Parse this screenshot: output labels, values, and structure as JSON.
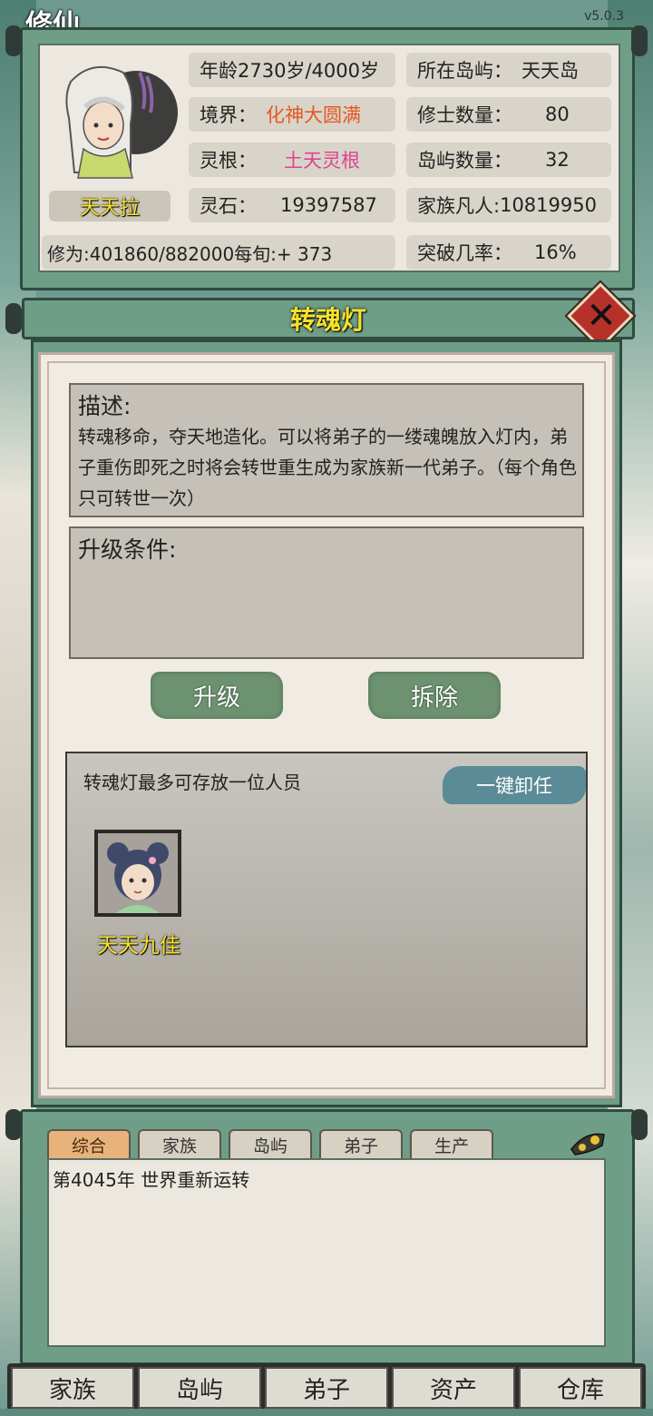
{
  "app": {
    "corner_title": "修仙",
    "version": "v5.0.3"
  },
  "info": {
    "player_name": "天天拉",
    "age": {
      "label": "年龄",
      "value": "2730岁/4000岁"
    },
    "island": {
      "label": "所在岛屿：",
      "value": "天天岛"
    },
    "realm": {
      "label": "境界：",
      "value": "化神大圆满"
    },
    "cultivator_count": {
      "label": "修士数量：",
      "value": "80"
    },
    "spirit_root": {
      "label": "灵根：",
      "value": "土天灵根"
    },
    "island_count": {
      "label": "岛屿数量：",
      "value": "32"
    },
    "spirit_stone": {
      "label": "灵石：",
      "value": "19397587"
    },
    "clan_mortals": {
      "label": "家族凡人:",
      "value": "10819950"
    },
    "cultivation": {
      "label": "修为:",
      "value": "401860/882000每旬:+ 373"
    },
    "breakthrough": {
      "label": "突破几率：",
      "value": "16%"
    },
    "colors": {
      "realm": "#e6571f",
      "spirit_root": "#e0428f",
      "name": "#f7e22a"
    }
  },
  "dialog": {
    "title": "转魂灯",
    "close_icon": "close-x-icon",
    "description_title": "描述:",
    "description_text": "转魂移命，夺天地造化。可以将弟子的一缕魂魄放入灯内，弟子重伤即死之时将会转世重生成为家族新一代弟子。（每个角色只可转世一次）",
    "upgrade_title": "升级条件:",
    "upgrade_button": "升级",
    "dismantle_button": "拆除",
    "lamp_caption": "转魂灯最多可存放一位人员",
    "unload_button": "一键卸任",
    "slots": [
      {
        "name": "天天九佳"
      }
    ]
  },
  "log": {
    "tabs": [
      "综合",
      "家族",
      "岛屿",
      "弟子",
      "生产"
    ],
    "active_tab": "综合",
    "entries": [
      "第4045年 世界重新运转"
    ]
  },
  "nav": {
    "items": [
      "家族",
      "岛屿",
      "弟子",
      "资产",
      "仓库"
    ]
  }
}
